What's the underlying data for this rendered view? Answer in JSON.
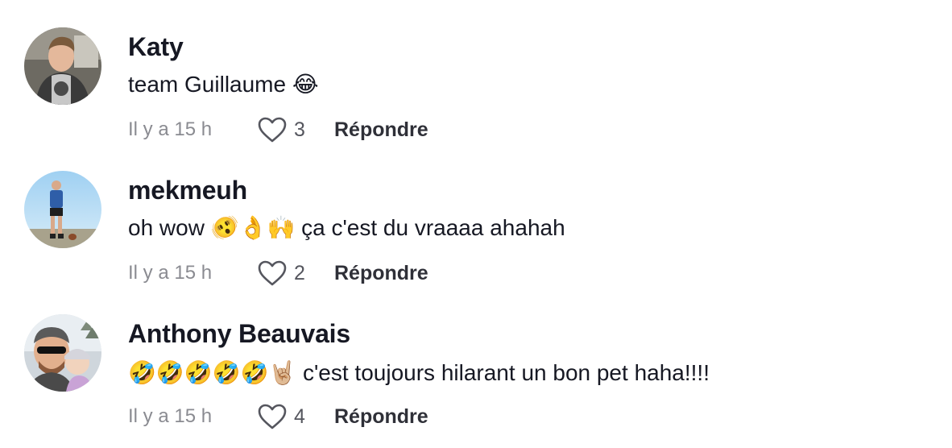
{
  "comments": [
    {
      "username": "Katy",
      "text": "team Guillaume 😂",
      "time": "Il y a 15 h",
      "likes": "3",
      "reply_label": "Répondre"
    },
    {
      "username": "mekmeuh",
      "text": "oh wow 🫨👌🙌 ça c'est du vraaaa ahahah",
      "time": "Il y a 15 h",
      "likes": "2",
      "reply_label": "Répondre"
    },
    {
      "username": "Anthony Beauvais",
      "text": "🤣🤣🤣🤣🤣🤘🏼 c'est toujours hilarant un bon pet haha!!!!",
      "time": "Il y a 15 h",
      "likes": "4",
      "reply_label": "Répondre"
    }
  ],
  "icons": {
    "like": "heart-outline-icon"
  },
  "colors": {
    "text_primary": "#161823",
    "text_secondary": "#8a8b91",
    "like_icon": "#55565e"
  }
}
